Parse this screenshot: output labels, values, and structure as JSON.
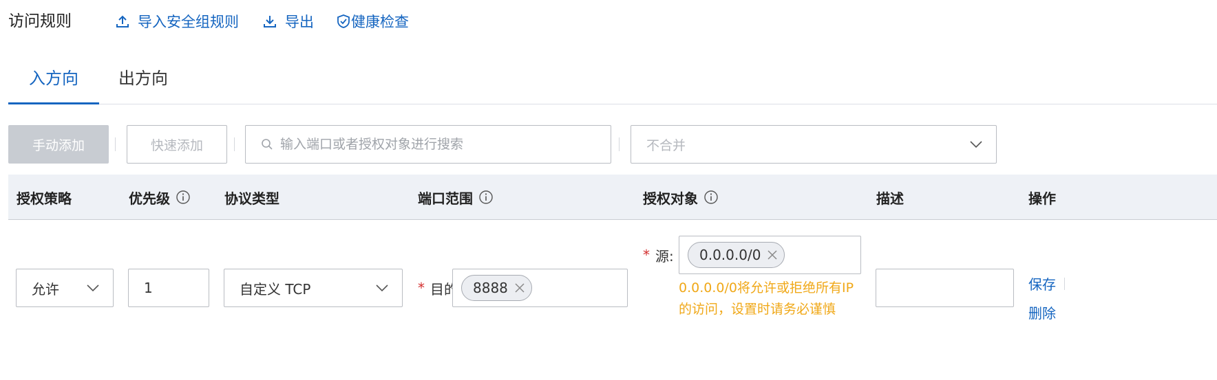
{
  "header": {
    "title": "访问规则",
    "actions": [
      {
        "label": "导入安全组规则",
        "icon": "upload-icon"
      },
      {
        "label": "导出",
        "icon": "download-icon"
      },
      {
        "label": "健康检查",
        "icon": "shield-check-icon"
      }
    ]
  },
  "tabs": [
    {
      "label": "入方向",
      "active": true
    },
    {
      "label": "出方向",
      "active": false
    }
  ],
  "toolbar": {
    "manual_add": "手动添加",
    "quick_add": "快速添加",
    "search_placeholder": "输入端口或者授权对象进行搜索",
    "merge_select": "不合并"
  },
  "table": {
    "columns": [
      {
        "label": "授权策略",
        "info": false
      },
      {
        "label": "优先级",
        "info": true
      },
      {
        "label": "协议类型",
        "info": false
      },
      {
        "label": "端口范围",
        "info": true
      },
      {
        "label": "授权对象",
        "info": true
      },
      {
        "label": "描述",
        "info": false
      },
      {
        "label": "操作",
        "info": false
      }
    ],
    "row": {
      "policy": "允许",
      "priority": "1",
      "protocol": "自定义 TCP",
      "port_label": "目的",
      "port_tag": "8888",
      "source_label": "源:",
      "source_tag": "0.0.0.0/0",
      "source_warning": "0.0.0.0/0将允许或拒绝所有IP的访问，设置时请务必谨慎",
      "description": "",
      "save": "保存",
      "delete": "删除"
    }
  },
  "colors": {
    "primary": "#1565c0",
    "warning": "#f0a818",
    "required": "#d32f2f"
  }
}
